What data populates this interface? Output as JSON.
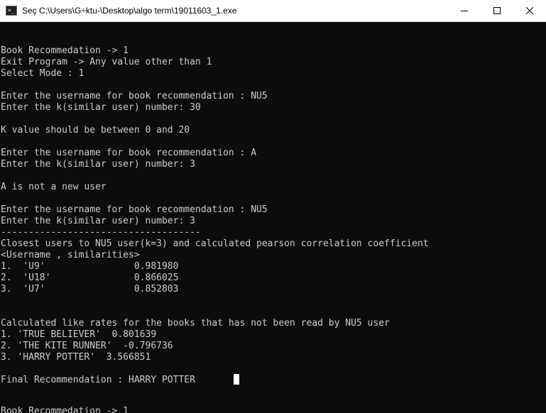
{
  "window": {
    "title": "Seç C:\\Users\\G÷ktu-\\Desktop\\algo term\\19011603_1.exe",
    "icon": "console-app-icon",
    "controls": [
      "minimize-icon",
      "maximize-icon",
      "close-icon"
    ]
  },
  "console": {
    "lines": [
      "Book Recommedation -> 1",
      "Exit Program -> Any value other than 1",
      "Select Mode : 1",
      "",
      "Enter the username for book recommendation : NU5",
      "Enter the k(similar user) number: 30",
      "",
      "K value should be between 0 and 20",
      "",
      "Enter the username for book recommendation : A",
      "Enter the k(similar user) number: 3",
      "",
      "A is not a new user",
      "",
      "Enter the username for book recommendation : NU5",
      "Enter the k(similar user) number: 3",
      "------------------------------------",
      "Closest users to NU5 user(k=3) and calculated pearson correlation coefficient",
      "<Username , similarities>",
      "1.  'U9'                0.981980",
      "2.  'U18'               0.866025",
      "3.  'U7'                0.852803",
      "",
      "",
      "Calculated like rates for the books that has not been read by NU5 user",
      "1. 'TRUE BELIEVER'  0.801639",
      "2. 'THE KITE RUNNER'  -0.796736",
      "3. 'HARRY POTTER'  3.566851",
      "",
      "Final Recommendation : HARRY POTTER",
      "",
      "",
      "Book Recommedation -> 1"
    ]
  }
}
